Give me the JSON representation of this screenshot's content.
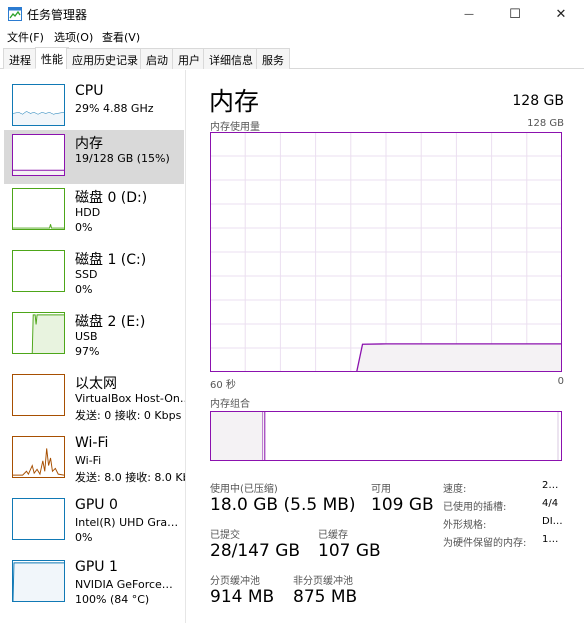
{
  "window": {
    "title": "任务管理器",
    "icon": "task-manager-icon",
    "minimize_glyph": "—",
    "maximize_glyph": "☐",
    "close_glyph": "✕"
  },
  "menu": [
    "文件(F)",
    "选项(O)",
    "查看(V)"
  ],
  "tabs": [
    "进程",
    "性能",
    "应用历史记录",
    "启动",
    "用户",
    "详细信息",
    "服务"
  ],
  "active_tab": "性能",
  "sidebar": {
    "items": [
      {
        "title": "CPU",
        "lines": [
          "29%  4.88 GHz"
        ],
        "color": "#1179b5"
      },
      {
        "title": "内存",
        "lines": [
          "19/128 GB (15%)"
        ],
        "color": "#8b12ae"
      },
      {
        "title": "磁盘 0 (D:)",
        "lines": [
          "HDD",
          "0%"
        ],
        "color": "#4da619"
      },
      {
        "title": "磁盘 1 (C:)",
        "lines": [
          "SSD",
          "0%"
        ],
        "color": "#4da619"
      },
      {
        "title": "磁盘 2 (E:)",
        "lines": [
          "USB",
          "97%"
        ],
        "color": "#4da619"
      },
      {
        "title": "以太网",
        "lines": [
          "VirtualBox Host-On…",
          "发送: 0 接收: 0 Kbps"
        ],
        "color": "#a74f01"
      },
      {
        "title": "Wi-Fi",
        "lines": [
          "Wi-Fi",
          "发送: 8.0 接收: 8.0 Kbps"
        ],
        "color": "#a74f01"
      },
      {
        "title": "GPU 0",
        "lines": [
          "Intel(R) UHD Gra…",
          "0%"
        ],
        "color": "#1179b5"
      },
      {
        "title": "GPU 1",
        "lines": [
          "NVIDIA GeForce…",
          "100% (84 °C)"
        ],
        "color": "#1179b5"
      }
    ]
  },
  "main": {
    "title": "内存",
    "total": "128 GB",
    "chart_label": "内存使用量",
    "chart_max": "128 GB",
    "axis_left": "60 秒",
    "axis_right": "0",
    "composition_label": "内存组合",
    "stats": {
      "in_use_label": "使用中(已压缩)",
      "in_use_value": "18.0 GB (5.5 MB)",
      "available_label": "可用",
      "available_value": "109 GB",
      "committed_label": "已提交",
      "committed_value": "28/147 GB",
      "cached_label": "已缓存",
      "cached_value": "107 GB",
      "paged_label": "分页缓冲池",
      "paged_value": "914 MB",
      "nonpaged_label": "非分页缓冲池",
      "nonpaged_value": "875 MB"
    },
    "details": [
      {
        "key": "速度:",
        "value": "2…"
      },
      {
        "key": "已使用的插槽:",
        "value": "4/4"
      },
      {
        "key": "外形规格:",
        "value": "DI…"
      },
      {
        "key": "为硬件保留的内存:",
        "value": "1…"
      }
    ]
  },
  "chart_data": {
    "type": "area",
    "x": [
      60,
      35,
      34,
      30,
      20,
      10,
      0
    ],
    "values": [
      0,
      0,
      14.8,
      15,
      15,
      15,
      15
    ],
    "ylim": [
      0,
      128
    ],
    "xlim": [
      60,
      0
    ],
    "grid": true,
    "color": "#8b12ae",
    "composition": {
      "in_use": 15,
      "modified": 0.5,
      "standby": 84.5
    }
  }
}
